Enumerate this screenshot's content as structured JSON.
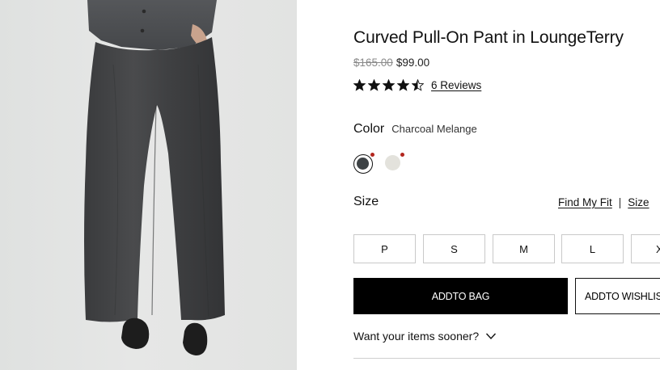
{
  "product": {
    "title": "Curved Pull-On Pant in LoungeTerry",
    "original_price": "$165.00",
    "sale_price": "$99.00",
    "rating_value": 4.5,
    "rating_out_of": 5,
    "reviews_label": "6 Reviews"
  },
  "color": {
    "label": "Color",
    "selected_name": "Charcoal Melange",
    "swatches": [
      {
        "name": "charcoal-melange",
        "hex": "#3d4245",
        "selected": true,
        "sale_dot": true
      },
      {
        "name": "cream",
        "hex": "#e3e2dc",
        "selected": false,
        "sale_dot": true
      }
    ]
  },
  "size": {
    "label": "Size",
    "find_my_fit": "Find My Fit",
    "separator": "|",
    "size_guide": "Size",
    "options": [
      "P",
      "S",
      "M",
      "L",
      "X"
    ]
  },
  "actions": {
    "add_to_bag": "ADDTO BAG",
    "add_to_wishlist": "ADDTO WISHLIS"
  },
  "shipping": {
    "sooner_label": "Want your items sooner?",
    "chevron_icon": "chevron-down-icon"
  },
  "colors": {
    "primary_button": "#000000",
    "sale_dot": "#b3261e",
    "strikethrough": "#8a8a8a"
  }
}
